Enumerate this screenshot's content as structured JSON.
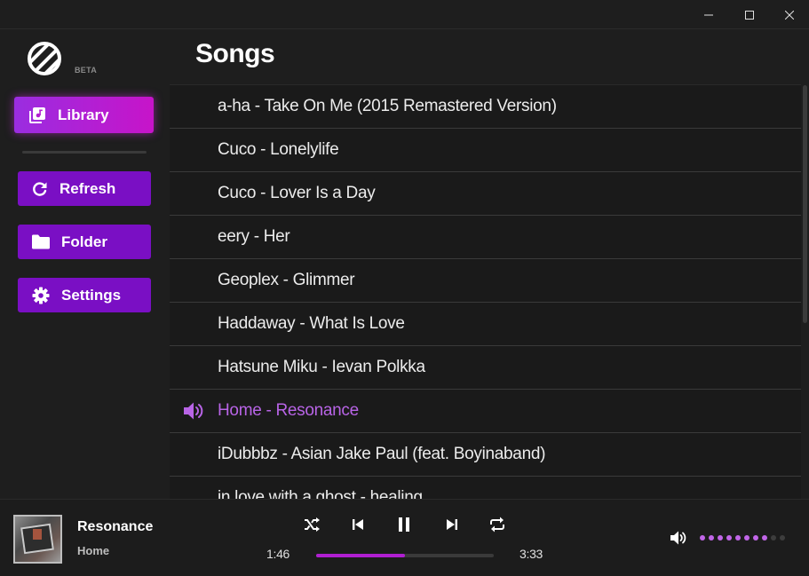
{
  "window": {
    "minimize_icon": "minimize-icon",
    "maximize_icon": "maximize-icon",
    "close_icon": "close-icon"
  },
  "sidebar": {
    "beta_label": "BETA",
    "items": [
      {
        "label": "Library",
        "icon": "library-icon",
        "active": true
      },
      {
        "label": "Refresh",
        "icon": "refresh-icon"
      },
      {
        "label": "Folder",
        "icon": "folder-icon"
      },
      {
        "label": "Settings",
        "icon": "gear-icon"
      }
    ]
  },
  "main": {
    "title": "Songs",
    "songs": [
      {
        "title": "a-ha - Take On Me (2015 Remastered Version)"
      },
      {
        "title": "Cuco - Lonelylife"
      },
      {
        "title": "Cuco - Lover Is a Day"
      },
      {
        "title": "eery - Her"
      },
      {
        "title": "Geoplex - Glimmer"
      },
      {
        "title": "Haddaway - What Is Love"
      },
      {
        "title": "Hatsune Miku - Ievan Polkka"
      },
      {
        "title": "Home - Resonance",
        "playing": true
      },
      {
        "title": "iDubbbz - Asian Jake Paul (feat. Boyinaband)"
      },
      {
        "title": "in love with a ghost - healing"
      }
    ]
  },
  "player": {
    "track_title": "Resonance",
    "artist": "Home",
    "current_time": "1:46",
    "total_time": "3:33",
    "progress": 0.5,
    "volume_level": 8,
    "volume_max": 10
  },
  "colors": {
    "accent": "#b01fd1",
    "playing_text": "#b864e6",
    "nav_button": "#7a0fc4"
  }
}
